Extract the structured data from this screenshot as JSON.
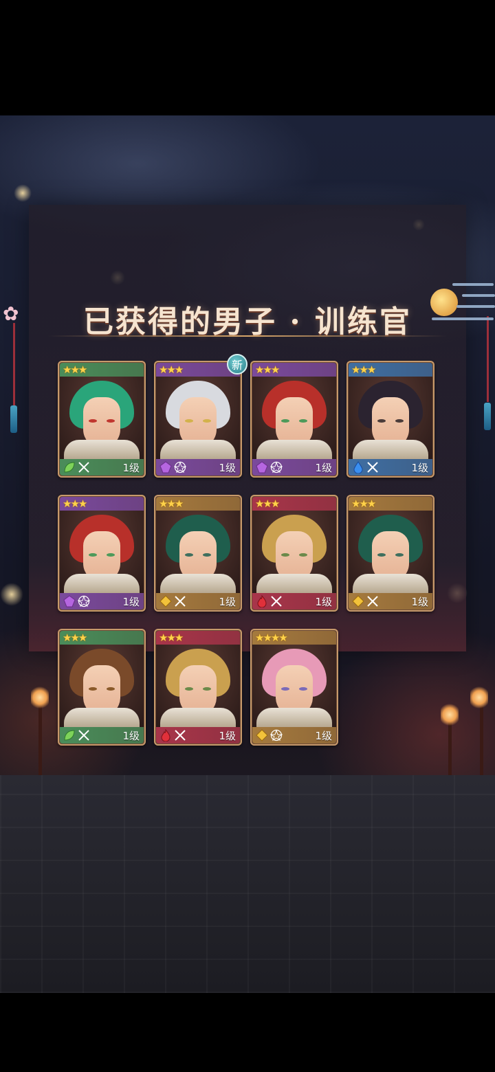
{
  "title": "已获得的男子 · 训练官",
  "colors": {
    "green": "#4a8d5a",
    "purple": "#7a4a9c",
    "red": "#a8354a",
    "blue": "#3f6fa3",
    "gold": "#a57a3e"
  },
  "new_badge": "新",
  "cards": [
    {
      "stars": "★★★",
      "element": "leaf-icon",
      "weapon": "crossed-swords-icon",
      "level": "1级",
      "band": "green",
      "hair": "#2aa57a",
      "eye": "#c0362f",
      "new": false
    },
    {
      "stars": "★★★",
      "element": "amethyst-icon",
      "weapon": "pentagram-icon",
      "level": "1级",
      "band": "purple",
      "hair": "#d8dadf",
      "eye": "#d3b24b",
      "new": true
    },
    {
      "stars": "★★★",
      "element": "amethyst-icon",
      "weapon": "pentagram-icon",
      "level": "1级",
      "band": "purple",
      "hair": "#b8302a",
      "eye": "#4d9a5a",
      "new": false
    },
    {
      "stars": "★★★",
      "element": "water-drop-icon",
      "weapon": "crossed-swords-icon",
      "level": "1级",
      "band": "blue",
      "hair": "#2b2330",
      "eye": "#4a3b3a",
      "new": false
    },
    {
      "stars": "★★★",
      "element": "amethyst-icon",
      "weapon": "pentagram-icon",
      "level": "1级",
      "band": "purple",
      "hair": "#b8302a",
      "eye": "#4d9a5a",
      "new": false
    },
    {
      "stars": "★★★",
      "element": "diamond-icon",
      "weapon": "crossed-swords-icon",
      "level": "1级",
      "band": "gold",
      "hair": "#1f5e4d",
      "eye": "#3f6f5e",
      "new": false
    },
    {
      "stars": "★★★",
      "element": "flame-icon",
      "weapon": "crossed-swords-icon",
      "level": "1级",
      "band": "red",
      "hair": "#caa04f",
      "eye": "#6b8a4a",
      "new": false
    },
    {
      "stars": "★★★",
      "element": "diamond-icon",
      "weapon": "crossed-swords-icon",
      "level": "1级",
      "band": "gold",
      "hair": "#1f5e4d",
      "eye": "#3f6f5e",
      "new": false
    },
    {
      "stars": "★★★",
      "element": "leaf-icon",
      "weapon": "crossed-swords-icon",
      "level": "1级",
      "band": "green",
      "hair": "#7a4a2a",
      "eye": "#8a5a2a",
      "new": false
    },
    {
      "stars": "★★★",
      "element": "flame-icon",
      "weapon": "crossed-swords-icon",
      "level": "1级",
      "band": "red",
      "hair": "#caa04f",
      "eye": "#6b8a4a",
      "new": false
    },
    {
      "stars": "★★★★",
      "element": "diamond-icon",
      "weapon": "pentagram-icon",
      "level": "1级",
      "band": "gold",
      "hair": "#e79ab7",
      "eye": "#7a6ab8",
      "new": false
    }
  ]
}
